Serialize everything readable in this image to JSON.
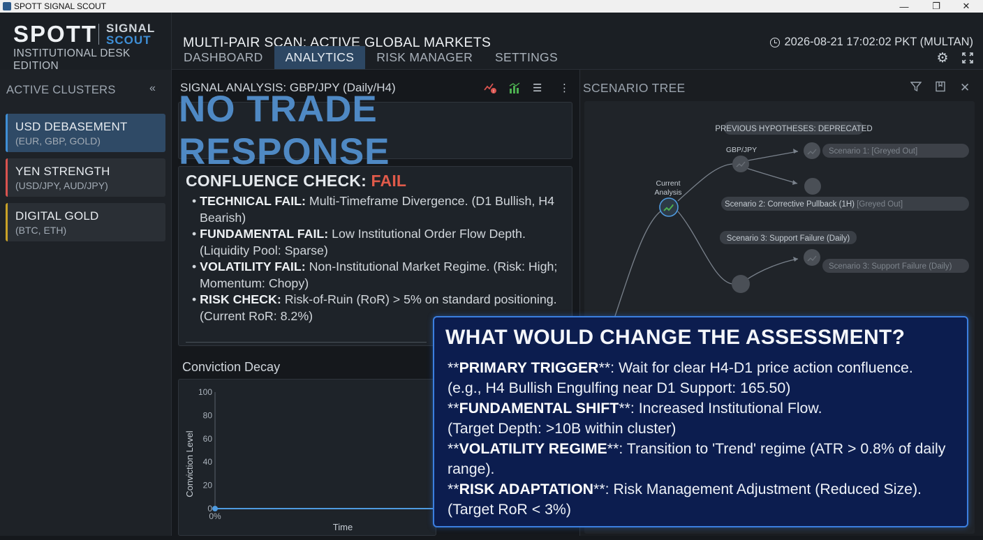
{
  "window": {
    "title": "SPOTT SIGNAL SCOUT"
  },
  "brand": {
    "name": "SPOTT",
    "sig1": "SIGNAL",
    "sig2": "SCOUT",
    "edition": "INSTITUTIONAL DESK EDITION"
  },
  "header": {
    "scan_title": "MULTI-PAIR SCAN: ACTIVE GLOBAL MARKETS",
    "clock": "2026-08-21 17:02:02 PKT (MULTAN)"
  },
  "nav": {
    "tabs": [
      {
        "label": "DASHBOARD",
        "active": false
      },
      {
        "label": "ANALYTICS",
        "active": true
      },
      {
        "label": "RISK MANAGER",
        "active": false
      },
      {
        "label": "SETTINGS",
        "active": false
      }
    ]
  },
  "sidebar": {
    "title": "ACTIVE CLUSTERS",
    "clusters": [
      {
        "name": "USD DEBASEMENT",
        "sub": "(EUR, GBP, GOLD)",
        "color": "#3f8fd6"
      },
      {
        "name": "YEN STRENGTH",
        "sub": "(USD/JPY, AUD/JPY)",
        "color": "#d9534f"
      },
      {
        "name": "DIGITAL GOLD",
        "sub": "(BTC, ETH)",
        "color": "#c9a227"
      }
    ]
  },
  "analysis": {
    "title": "SIGNAL ANALYSIS: GBP/JPY (Daily/H4)",
    "headline": "NO TRADE RESPONSE",
    "confluence": {
      "label": "CONFLUENCE CHECK:",
      "status": "FAIL",
      "items": [
        {
          "head": "TECHNICAL FAIL:",
          "text": "Multi-Timeframe Divergence. (D1 Bullish, H4 Bearish)"
        },
        {
          "head": "FUNDAMENTAL FAIL:",
          "text": "Low Institutional Order Flow Depth. (Liquidity Pool: Sparse)"
        },
        {
          "head": "VOLATILITY FAIL:",
          "text": "Non-Institutional Market Regime. (Risk: High; Momentum: Chopy)"
        },
        {
          "head": "RISK CHECK:",
          "text": "Risk-of-Ruin (RoR) > 5% on standard positioning. (Current RoR: 8.2%)"
        }
      ]
    }
  },
  "decay": {
    "title": "Conviction Decay"
  },
  "chart_data": {
    "type": "line",
    "title": "Conviction Decay",
    "xlabel": "Time",
    "ylabel": "Conviction Level",
    "ylim": [
      0,
      100
    ],
    "yticks": [
      "0",
      "20",
      "40",
      "60",
      "80",
      "100"
    ],
    "xticks": [
      "0%"
    ],
    "series": [
      {
        "values": [
          0,
          0
        ]
      }
    ],
    "color": "#4f9be0"
  },
  "scenario": {
    "title": "SCENARIO TREE",
    "prev_label": "PREVIOUS HYPOTHESES: DEPRECATED",
    "pair_label": "GBP/JPY",
    "current_label1": "Current",
    "current_label2": "Analysis",
    "s1": "Scenario 1: [Greyed Out]",
    "s2a": "Scenario 2: Corrective Pullback (1H)",
    "s2b": " [Greyed Out]",
    "s3": "Scenario 3: Support Failure (Daily)",
    "s3b": "Scenario 3: Support Failure (Daily)"
  },
  "overlay": {
    "title": "WHAT WOULD CHANGE THE ASSESSMENT?",
    "lines": [
      {
        "pre": "**",
        "head": "PRIMARY TRIGGER",
        "post": "**: Wait for clear H4-D1 price action confluence."
      },
      {
        "text": "(e.g., H4 Bullish Engulfing near D1 Support: 165.50)"
      },
      {
        "pre": "**",
        "head": "FUNDAMENTAL SHIFT",
        "post": "**: Increased Institutional Flow."
      },
      {
        "text": "(Target Depth: >10B within cluster)"
      },
      {
        "pre": "**",
        "head": "VOLATILITY REGIME",
        "post": "**: Transition to 'Trend' regime (ATR > 0.8% of daily range)."
      },
      {
        "pre": "**",
        "head": "RISK ADAPTATION",
        "post": "**: Risk Management Adjustment (Reduced Size)."
      },
      {
        "text": "(Target RoR < 3%)"
      }
    ]
  },
  "colors": {
    "accent": "#3f8fd6",
    "fail": "#e05a4a",
    "overlay_bg": "#0c1d4f",
    "overlay_border": "#3b7fe0"
  }
}
